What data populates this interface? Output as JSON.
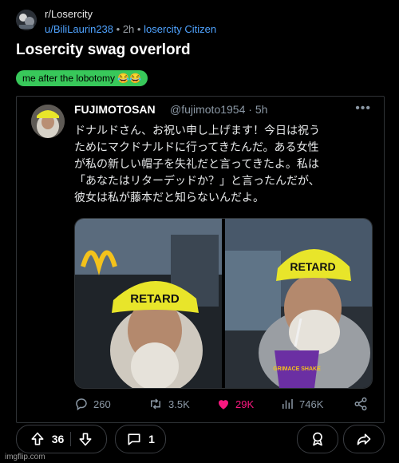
{
  "post": {
    "subreddit": "r/Losercity",
    "author": "u/BiliLaurin238",
    "dot": "•",
    "time": "2h",
    "author_flair": "losercity Citizen",
    "title": "Losercity swag overlord",
    "flair": "me after the lobotomy 😂😂"
  },
  "tweet": {
    "display_name": "FUJIMOTOSAN",
    "handle_time": "@fujimoto1954 · 5h",
    "more_icon": "more-horizontal-icon",
    "text": "ドナルドさん、お祝い申し上げます！今日は祝う\nためにマクドナルドに行ってきたんだ。ある女性\nが私の新しい帽子を失礼だと言ってきたよ。私は\n「あなたはリターデッドか？」と言ったんだが、\n彼女は私が藤本だと知らないんだよ。",
    "hat_text": "RETARD",
    "cup_text": "GRIMACE SHAKE",
    "replies": "260",
    "retweets": "3.5K",
    "likes": "29K",
    "views": "746K",
    "accent_like": "#f91880"
  },
  "actions": {
    "upvotes": "36",
    "comments": "1"
  },
  "watermark": "imgflip.com",
  "colors": {
    "background": "#000000",
    "link": "#4fa3ff",
    "flair_bg": "#38c85a",
    "hat_yellow": "#e8e52a",
    "cup_purple": "#6b2fa3"
  }
}
